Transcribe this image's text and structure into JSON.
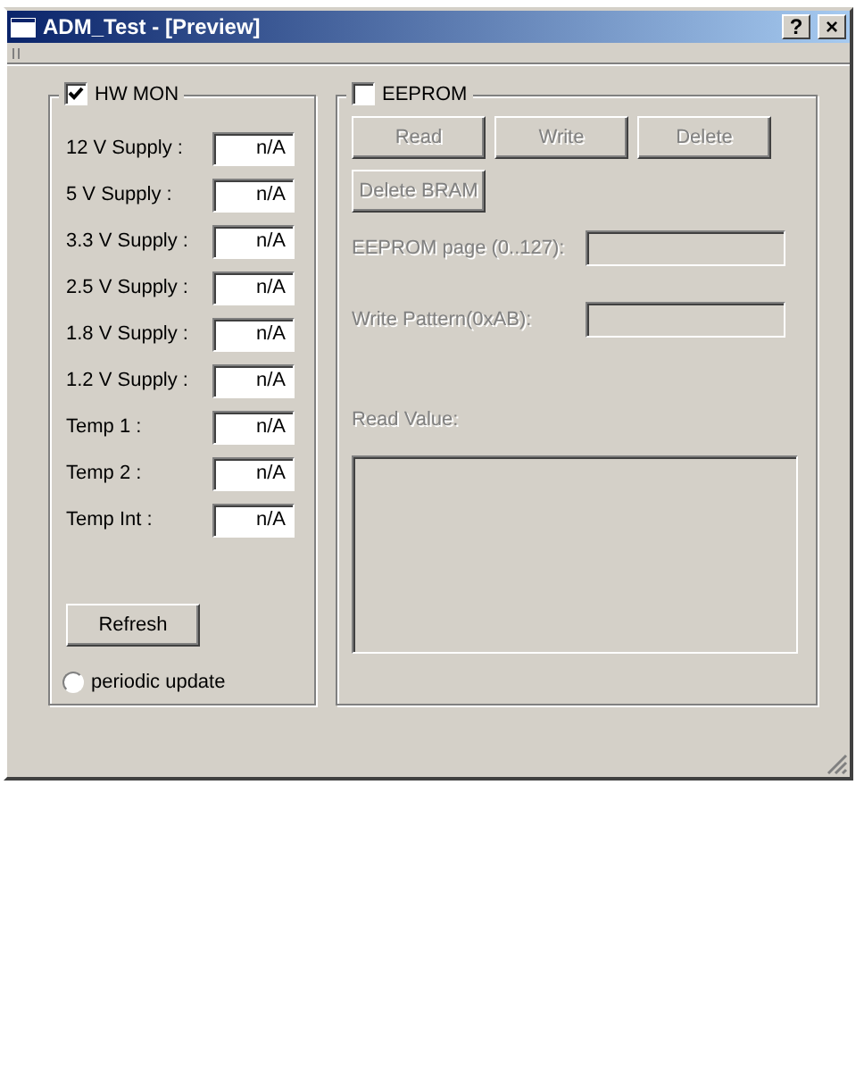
{
  "window": {
    "title": "ADM_Test - [Preview]",
    "buttons": [
      {
        "label": "?"
      },
      {
        "label": "×"
      }
    ]
  },
  "hw_mon": {
    "label": "HW MON",
    "checked": true,
    "rows": [
      {
        "label": "12 V Supply :",
        "value": "n/A"
      },
      {
        "label": "5 V Supply :",
        "value": "n/A"
      },
      {
        "label": "3.3 V Supply :",
        "value": "n/A"
      },
      {
        "label": "2.5 V Supply :",
        "value": "n/A"
      },
      {
        "label": "1.8 V Supply :",
        "value": "n/A"
      },
      {
        "label": "1.2 V Supply :",
        "value": "n/A"
      },
      {
        "label": "Temp 1 :",
        "value": "n/A"
      },
      {
        "label": "Temp 2 :",
        "value": "n/A"
      },
      {
        "label": "Temp Int :",
        "value": "n/A"
      }
    ],
    "refresh_button": "Refresh",
    "periodic_update": {
      "label": "periodic update",
      "selected": false
    }
  },
  "eeprom": {
    "label": "EEPROM",
    "checked": false,
    "buttons": [
      {
        "label": "Read",
        "disabled": true
      },
      {
        "label": "Write",
        "disabled": true
      },
      {
        "label": "Delete",
        "disabled": true
      },
      {
        "label": "Delete BRAM",
        "disabled": true
      }
    ],
    "fields": [
      {
        "label": "EEPROM page (0..127):",
        "disabled": true
      },
      {
        "label": "Write Pattern(0xAB):",
        "disabled": true
      }
    ],
    "read_value": {
      "label": "Read Value:",
      "disabled": true
    }
  }
}
